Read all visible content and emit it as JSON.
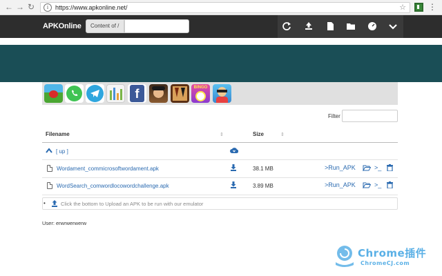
{
  "browser": {
    "url": "https://www.apkonline.net/"
  },
  "navbar": {
    "brand": "APKOnline",
    "content_of_label": "Content of /",
    "path_value": "",
    "icons": [
      "refresh-icon",
      "upload-icon",
      "new-file-icon",
      "folder-icon",
      "dashboard-icon",
      "chevron-down-icon"
    ]
  },
  "apps": [
    "angry-birds",
    "whatsapp",
    "telegram",
    "charts",
    "facebook",
    "pirate-game",
    "backgammon",
    "bingo",
    "subway-surfer"
  ],
  "filter": {
    "label": "Filter",
    "value": ""
  },
  "table": {
    "columns": [
      "Filename",
      "Size"
    ],
    "up_label": "[ up ]",
    "rows": [
      {
        "name": "Wordament_commicrosoftwordament.apk",
        "size": "38.1 MB",
        "run": ">Run_APK",
        "term": ">_"
      },
      {
        "name": "WordSearch_comwordlocowordchallenge.apk",
        "size": "3.89 MB",
        "run": ">Run_APK",
        "term": ">_"
      }
    ]
  },
  "upload": {
    "text": "Click the bottom to Upload an APK to be run with our emulator"
  },
  "user": {
    "text": "User: erwrwerwerw"
  },
  "watermark": {
    "brand": "Chrome插件",
    "site": "ChromeCJ.com"
  },
  "colors": {
    "navbar": "#2d2d2d",
    "banner": "#1a4e56",
    "link": "#2a6ab0"
  }
}
